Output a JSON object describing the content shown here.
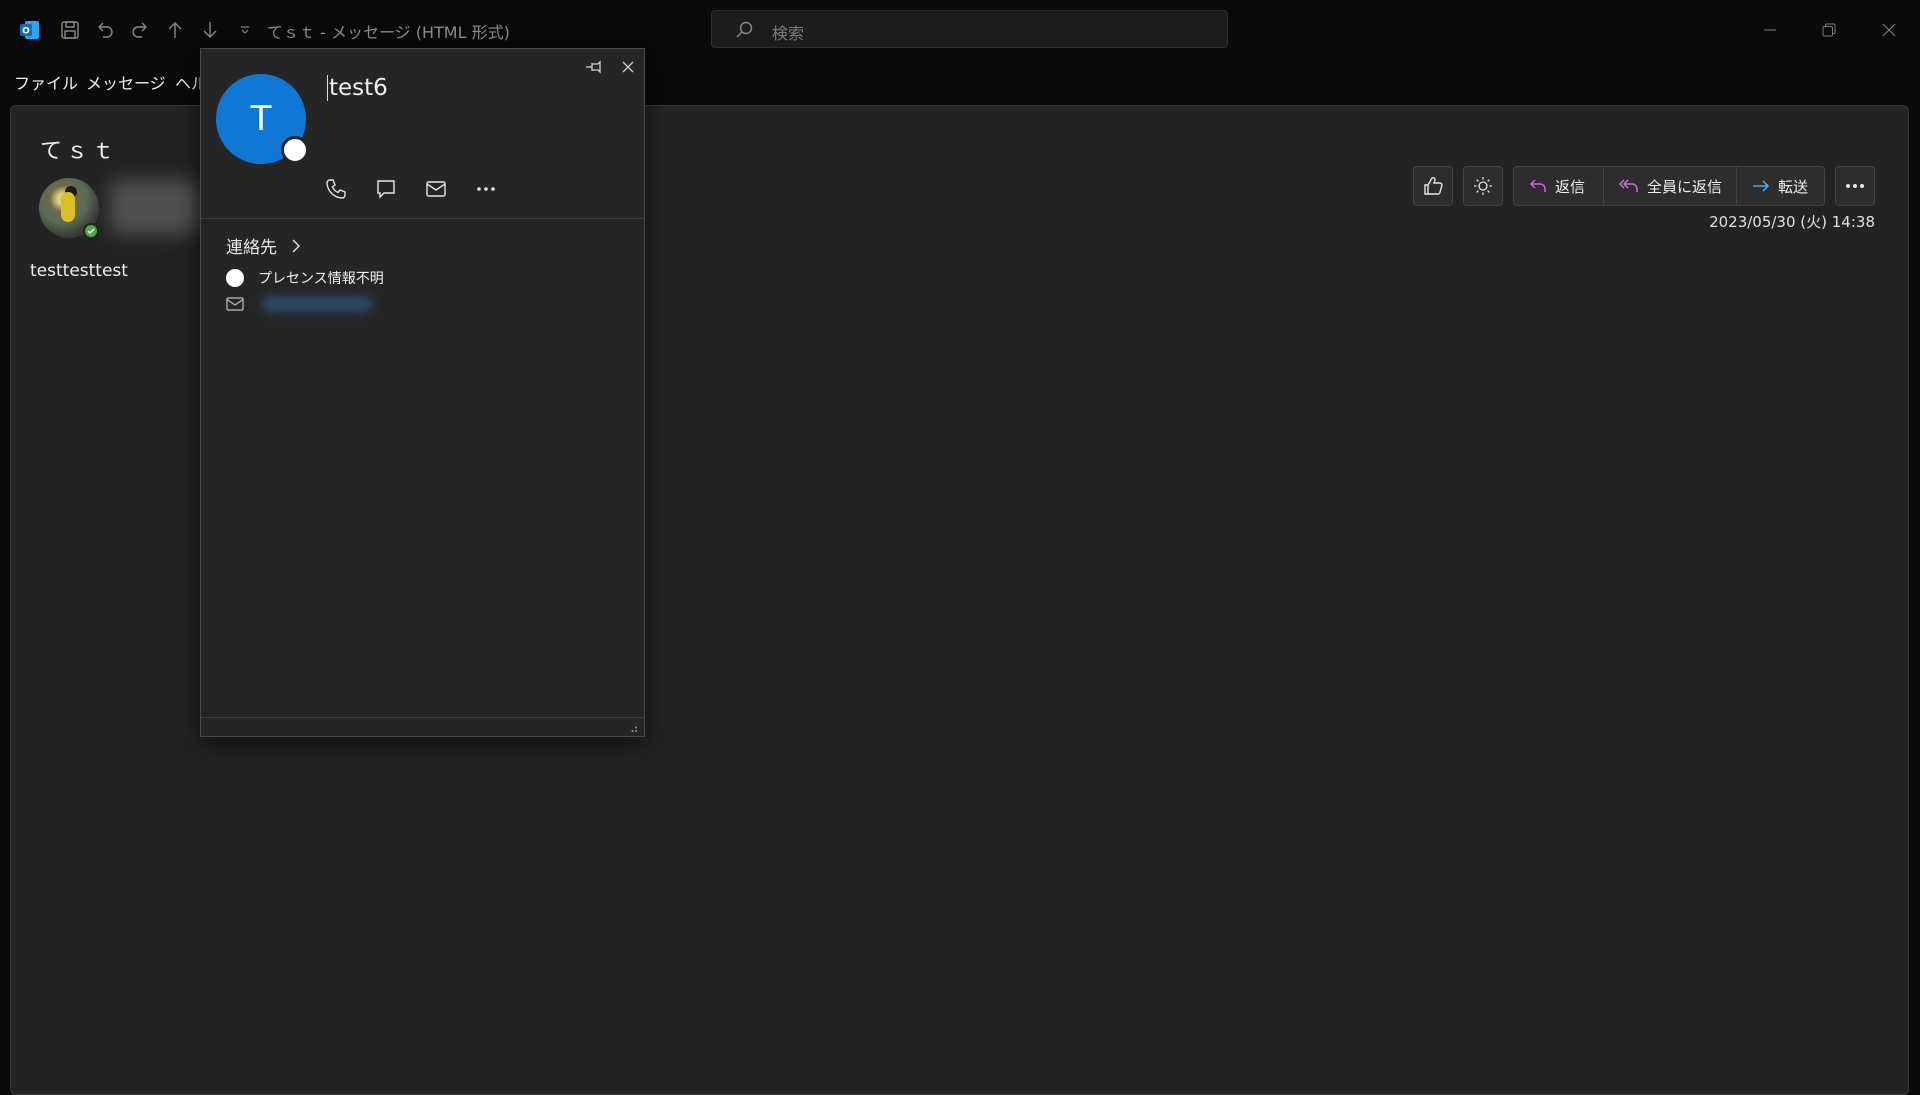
{
  "titlebar": {
    "window_title": "てｓｔ - メッセージ (HTML 形式)",
    "search_placeholder": "検索"
  },
  "menu": {
    "file": "ファイル",
    "message": "メッセージ",
    "help": "ヘル"
  },
  "message": {
    "subject": "てｓｔ",
    "body": "testtesttest",
    "timestamp": "2023/05/30 (火) 14:38",
    "actions": {
      "reply": "返信",
      "reply_all": "全員に返信",
      "forward": "転送"
    }
  },
  "contact_card": {
    "initial": "T",
    "name": "test6",
    "contacts_label": "連絡先",
    "presence_text": "プレセンス情報不明"
  },
  "colors": {
    "accent_blue": "#0f78d4",
    "reply_icon": "#c670d6",
    "forward_icon": "#5aa7f0",
    "status_green": "#57a64a"
  },
  "icons": [
    "outlook-icon",
    "save-icon",
    "undo-icon",
    "redo-icon",
    "up-arrow-icon",
    "down-arrow-icon",
    "customize-icon",
    "search-icon",
    "minimize-icon",
    "restore-icon",
    "close-icon",
    "thumbs-up-icon",
    "sun-icon",
    "reply-icon",
    "reply-all-icon",
    "forward-icon",
    "more-icon",
    "pin-icon",
    "phone-icon",
    "chat-icon",
    "mail-icon",
    "chevron-right-icon"
  ]
}
